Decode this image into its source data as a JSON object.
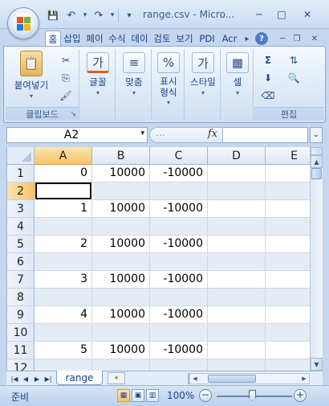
{
  "window": {
    "title": "range.csv - Micro...",
    "controls": {
      "minimize": "─",
      "maximize": "□",
      "close": "✕"
    }
  },
  "quick_access": {
    "save": "💾",
    "undo": "↶",
    "undo_dd": "▾",
    "redo": "↷",
    "redo_dd": "▾",
    "customize": "▾"
  },
  "tabs": [
    {
      "label": "홈"
    },
    {
      "label": "삽입"
    },
    {
      "label": "페이"
    },
    {
      "label": "수식"
    },
    {
      "label": "데이"
    },
    {
      "label": "검토"
    },
    {
      "label": "보기"
    },
    {
      "label": "PDI"
    },
    {
      "label": "Acr"
    }
  ],
  "tab_controls": {
    "more": "▸",
    "help": "?",
    "min": "─",
    "restore": "❐",
    "close": "✕"
  },
  "ribbon": {
    "clipboard": {
      "paste_label": "붙여넣기",
      "paste_caret": "▾",
      "group_label": "클립보드",
      "cut": "✂",
      "copy": "⎘",
      "format_painter": "🖌",
      "launcher": "↘"
    },
    "font": {
      "label": "글꼴",
      "icon": "가",
      "caret": "▾"
    },
    "alignment": {
      "label": "맞춤",
      "icon": "≡",
      "caret": "▾"
    },
    "number": {
      "label_line1": "표시",
      "label_line2": "형식",
      "icon": "%",
      "caret": "▾"
    },
    "styles": {
      "label": "스타일",
      "icon": "가",
      "caret": "▾"
    },
    "cells": {
      "label": "셀",
      "icon": "▦",
      "caret": "▾"
    },
    "editing": {
      "group_label": "편집",
      "sum": "Σ",
      "sort_filter": "⇅",
      "find": "🔍",
      "fill": "⬇",
      "clear": "⌫"
    }
  },
  "formula_bar": {
    "name_box": "A2",
    "name_dd": "▾",
    "dots": "⋯",
    "fx": "fx",
    "value": "",
    "expand": "⌄"
  },
  "grid": {
    "corner": "",
    "columns": [
      "A",
      "B",
      "C",
      "D",
      "E"
    ],
    "selected_column": "A",
    "selected_row": "2",
    "active_cell": "A2",
    "rows": [
      {
        "num": "1",
        "cells": [
          "0",
          "10000",
          "-10000",
          "",
          ""
        ]
      },
      {
        "num": "2",
        "cells": [
          "",
          "",
          "",
          "",
          ""
        ]
      },
      {
        "num": "3",
        "cells": [
          "1",
          "10000",
          "-10000",
          "",
          ""
        ]
      },
      {
        "num": "4",
        "cells": [
          "",
          "",
          "",
          "",
          ""
        ]
      },
      {
        "num": "5",
        "cells": [
          "2",
          "10000",
          "-10000",
          "",
          ""
        ]
      },
      {
        "num": "6",
        "cells": [
          "",
          "",
          "",
          "",
          ""
        ]
      },
      {
        "num": "7",
        "cells": [
          "3",
          "10000",
          "-10000",
          "",
          ""
        ]
      },
      {
        "num": "8",
        "cells": [
          "",
          "",
          "",
          "",
          ""
        ]
      },
      {
        "num": "9",
        "cells": [
          "4",
          "10000",
          "-10000",
          "",
          ""
        ]
      },
      {
        "num": "10",
        "cells": [
          "",
          "",
          "",
          "",
          ""
        ]
      },
      {
        "num": "11",
        "cells": [
          "5",
          "10000",
          "-10000",
          "",
          ""
        ]
      },
      {
        "num": "12",
        "cells": [
          "",
          "",
          "",
          "",
          ""
        ]
      }
    ]
  },
  "scrollbar": {
    "up": "▲",
    "down": "▼",
    "left": "◀",
    "right": "▶"
  },
  "sheets": {
    "nav_first": "|◀",
    "nav_prev": "◀",
    "nav_next": "▶",
    "nav_last": "▶|",
    "tabs": [
      "range"
    ],
    "insert_icon": "✦"
  },
  "status": {
    "ready": "준비",
    "view_normal": "▦",
    "view_layout": "▣",
    "view_pagebreak": "▥",
    "zoom": "100%",
    "zoom_minus": "−",
    "zoom_plus": "+",
    "zoom_level_percent": 100
  },
  "colors": {
    "accent": "#c5d7ee",
    "selection": "#f8c469",
    "shaded_row": "#e6ecf5"
  }
}
